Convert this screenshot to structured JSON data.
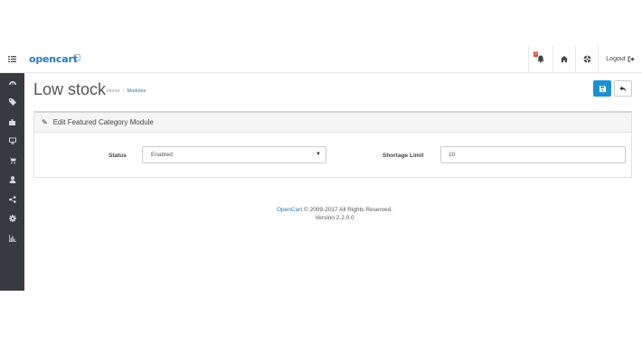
{
  "header": {
    "logo": "opencart",
    "logo_cart": "⧠",
    "notification_count": "3",
    "logout_label": "Logout"
  },
  "sidebar": {
    "items": [
      "dashboard-icon",
      "tag-icon",
      "puzzle-icon",
      "desktop-icon",
      "cart-icon",
      "user-icon",
      "share-icon",
      "cog-icon",
      "bar-chart-icon"
    ]
  },
  "page": {
    "title": "Low stock",
    "breadcrumb": [
      "Home",
      "Modules"
    ]
  },
  "panel": {
    "title": "Edit Featured Category Module",
    "status_label": "Status",
    "status_value": "Enabled",
    "shortage_label": "Shortage Limit",
    "shortage_value": "10"
  },
  "footer": {
    "brand": "OpenCart",
    "copyright": " © 2009-2017 All Rights Reserved.",
    "version": "Version 2.2.0.0"
  },
  "colors": {
    "accent": "#1e91cf",
    "sidebar_bg": "#373a3e",
    "link": "#2d7bb8"
  }
}
